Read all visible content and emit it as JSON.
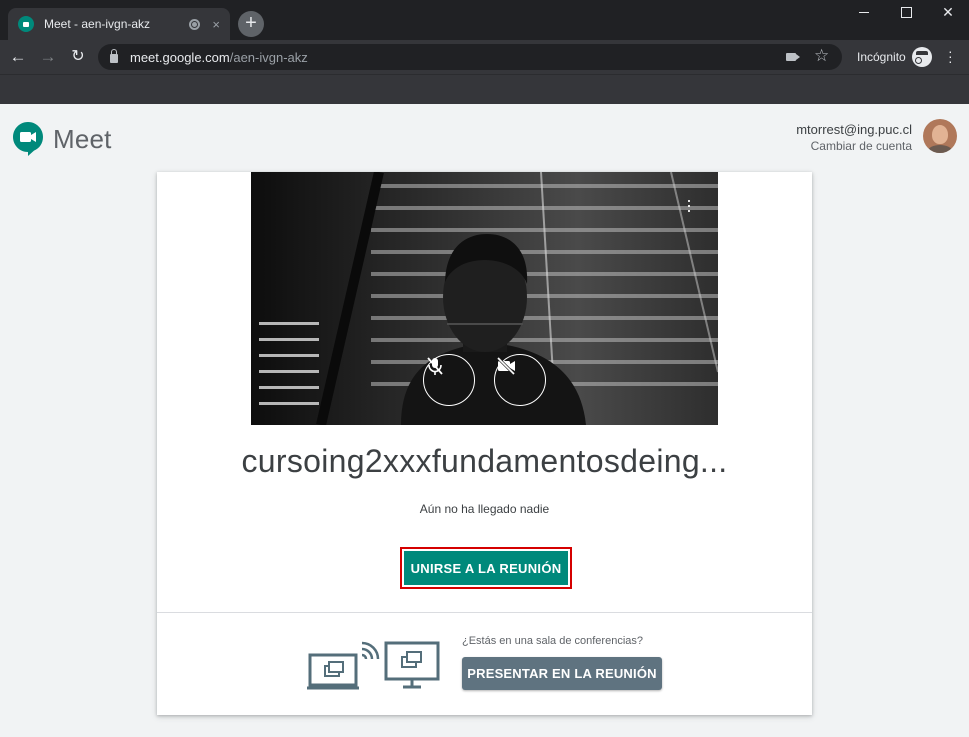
{
  "browser": {
    "tab_title": "Meet - aen-ivgn-akz",
    "tab_close": "×",
    "new_tab": "+",
    "url_host": "meet.google.com",
    "url_path": "/aen-ivgn-akz",
    "incognito_label": "Incógnito",
    "icons": [
      "back-arrow-icon",
      "forward-arrow-icon",
      "reload-icon",
      "lock-icon",
      "camera-icon",
      "star-icon",
      "incognito-icon",
      "menu-icon"
    ]
  },
  "header": {
    "logo_text": "Meet",
    "account_email": "mtorrest@ing.puc.cl",
    "switch_account": "Cambiar de cuenta"
  },
  "preview": {
    "icons": [
      "more-options-icon",
      "mic-off-icon",
      "camera-off-icon"
    ]
  },
  "meeting": {
    "name": "cursoing2xxxfundamentosdeing...",
    "status": "Aún no ha llegado nadie",
    "join_label": "UNIRSE A LA REUNIÓN"
  },
  "room": {
    "question": "¿Estás en una sala de conferencias?",
    "present_label": "PRESENTAR EN LA REUNIÓN"
  },
  "colors": {
    "join_button": "#00897b",
    "join_highlight": "#d50000",
    "present_button": "#5f7380",
    "brand": "#00897b"
  }
}
